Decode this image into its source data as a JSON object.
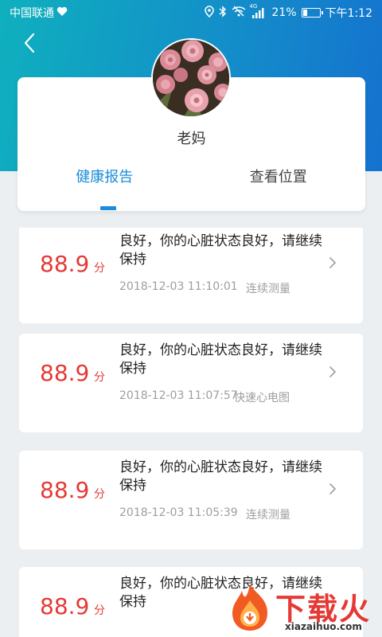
{
  "status_bar": {
    "carrier": "中国联通",
    "network": "4G",
    "battery": "21%",
    "time": "下午1:12"
  },
  "profile": {
    "name": "老妈"
  },
  "tabs": [
    {
      "label": "健康报告",
      "active": true
    },
    {
      "label": "查看位置",
      "active": false
    }
  ],
  "reports": [
    {
      "score": "88.9",
      "unit": "分",
      "message": "良好，你的心脏状态良好，请继续保持",
      "datetime": "2018-12-03 11:10:01",
      "type": "连续测量"
    },
    {
      "score": "88.9",
      "unit": "分",
      "message": "良好，你的心脏状态良好，请继续保持",
      "datetime": "2018-12-03 11:07:57",
      "type": "快速心电图"
    },
    {
      "score": "88.9",
      "unit": "分",
      "message": "良好，你的心脏状态良好，请继续保持",
      "datetime": "2018-12-03 11:05:39",
      "type": "连续测量"
    },
    {
      "score": "88.9",
      "unit": "分",
      "message": "良好，你的心脏状态良好，请继续保持",
      "datetime": "",
      "type": ""
    }
  ],
  "watermark": {
    "text": "下载火",
    "url": "xiazaihuo.com"
  },
  "colors": {
    "accent": "#1a8cd8",
    "score": "#e53935",
    "header_start": "#0fb0be",
    "header_end": "#1572cf"
  }
}
